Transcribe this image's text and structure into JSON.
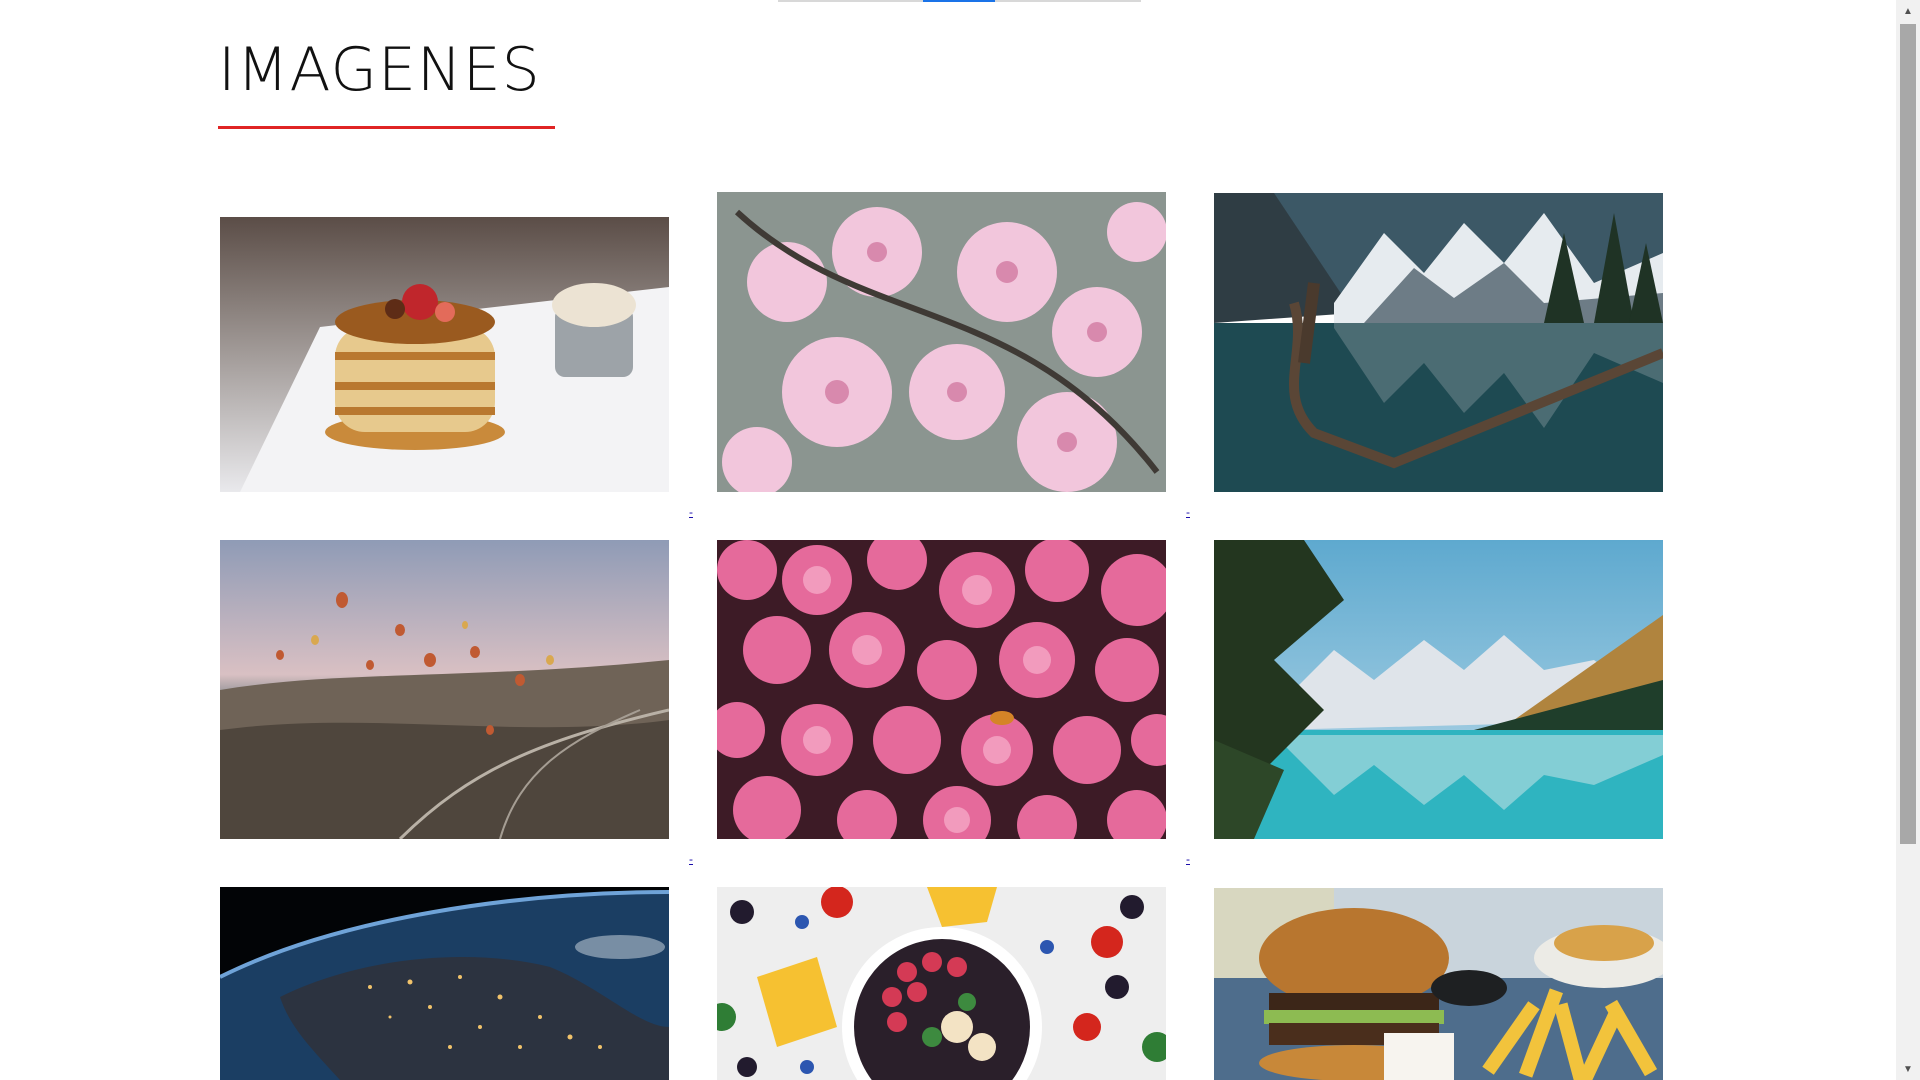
{
  "page": {
    "title": "IMAGENES"
  },
  "gallery": {
    "items": [
      {
        "name": "pancakes",
        "alt": "pancakes"
      },
      {
        "name": "cherry-blossoms",
        "alt": "cherry blossoms"
      },
      {
        "name": "mountain-lake-driftwood",
        "alt": "mountain lake"
      },
      {
        "name": "hot-air-balloons",
        "alt": "hot air balloons"
      },
      {
        "name": "pink-flowers",
        "alt": "pink flowers"
      },
      {
        "name": "turquoise-lake",
        "alt": "turquoise lake"
      },
      {
        "name": "earth-at-night",
        "alt": "earth at night"
      },
      {
        "name": "fruit-bowl",
        "alt": "fruit bowl"
      },
      {
        "name": "burger-and-fries",
        "alt": "burger and fries"
      }
    ],
    "link_marker": "-"
  },
  "colors": {
    "title_underline": "#e02424",
    "tab_active": "#1a73e8"
  }
}
